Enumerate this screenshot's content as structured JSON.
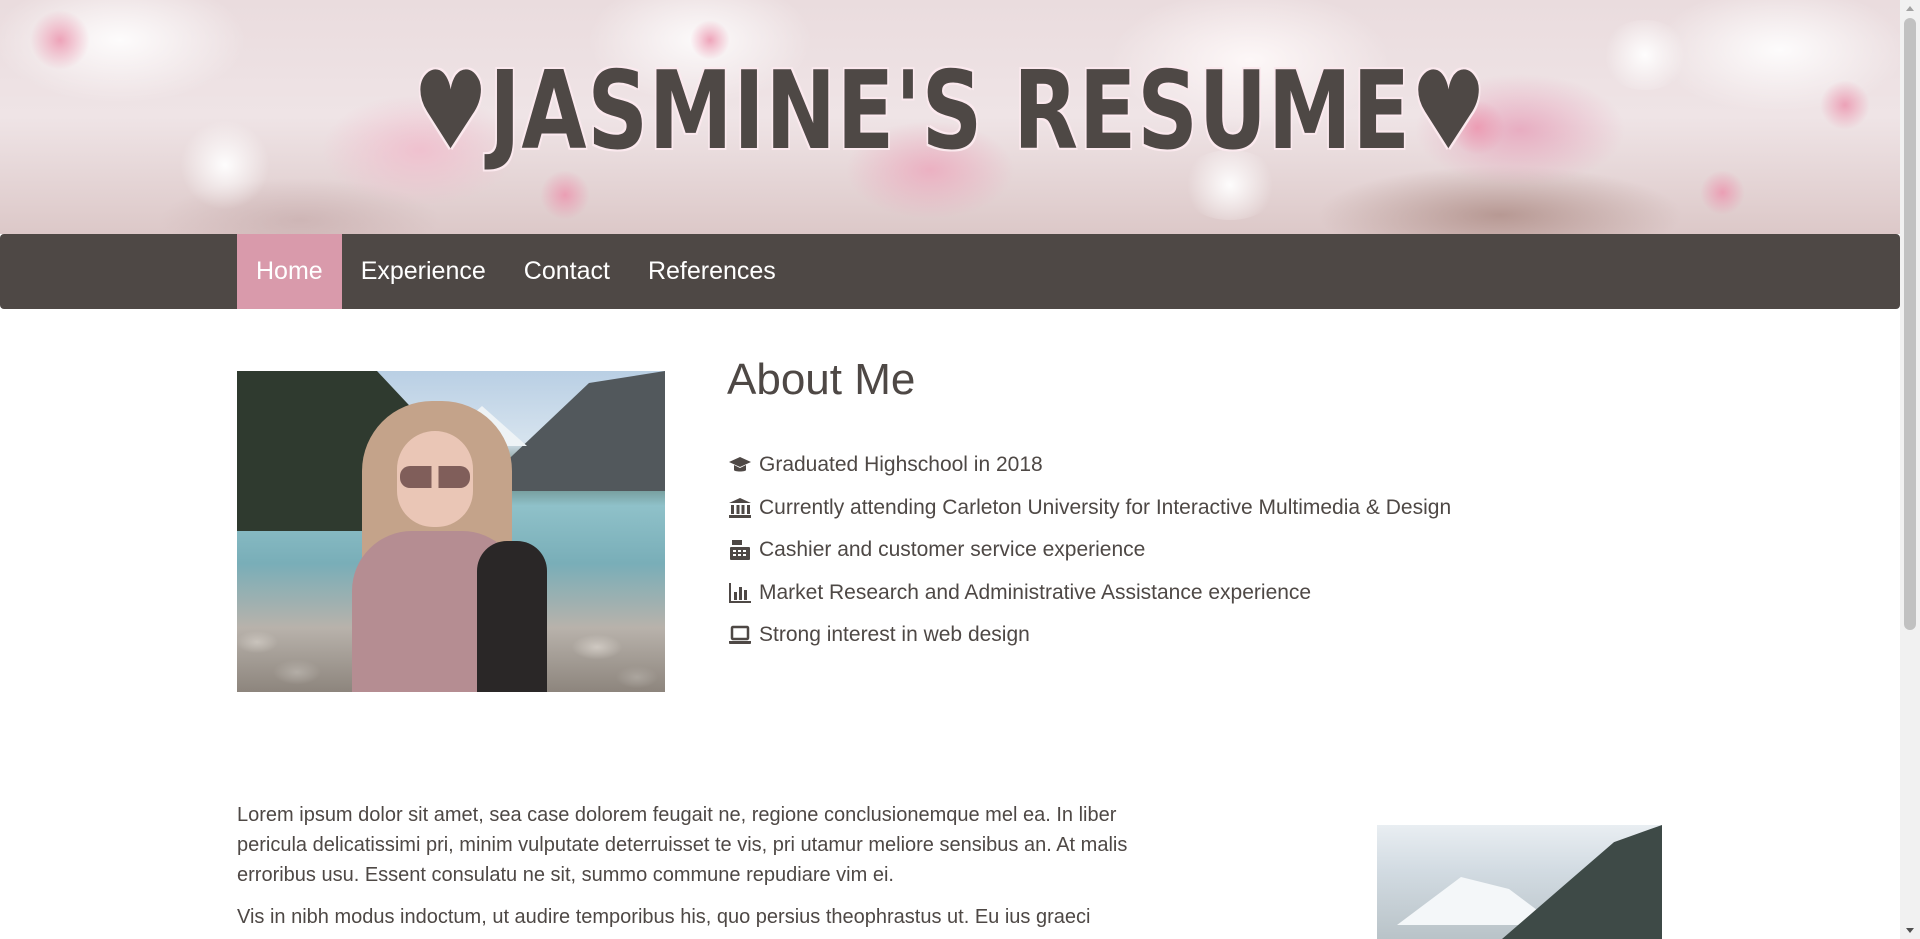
{
  "banner": {
    "title": "♥JASMINE'S RESUME♥"
  },
  "nav": {
    "items": [
      {
        "label": "Home",
        "active": true
      },
      {
        "label": "Experience",
        "active": false
      },
      {
        "label": "Contact",
        "active": false
      },
      {
        "label": "References",
        "active": false
      }
    ]
  },
  "about": {
    "title": "About Me",
    "items": [
      {
        "icon": "graduation-cap-icon",
        "text": "Graduated Highschool in 2018"
      },
      {
        "icon": "university-icon",
        "text": "Currently attending Carleton University for Interactive Multimedia & Design"
      },
      {
        "icon": "cash-register-icon",
        "text": "Cashier and customer service experience"
      },
      {
        "icon": "bar-chart-icon",
        "text": "Market Research and Administrative Assistance experience"
      },
      {
        "icon": "laptop-icon",
        "text": "Strong interest in web design"
      }
    ]
  },
  "lorem": {
    "paragraphs": [
      "Lorem ipsum dolor sit amet, sea case dolorem feugait ne, regione conclusionemque mel ea. In liber pericula delicatissimi pri, minim vulputate deterruisset te vis, pri utamur meliore sensibus an. At malis erroribus usu. Essent consulatu ne sit, summo commune repudiare vim ei.",
      "Vis in nibh modus indoctum, ut audire temporibus his, quo persius theophrastus ut. Eu ius graeci"
    ]
  },
  "colors": {
    "text": "#4e4845",
    "nav_bg": "#4e4845",
    "nav_active": "#d99aab",
    "nav_text": "#ffffff"
  }
}
